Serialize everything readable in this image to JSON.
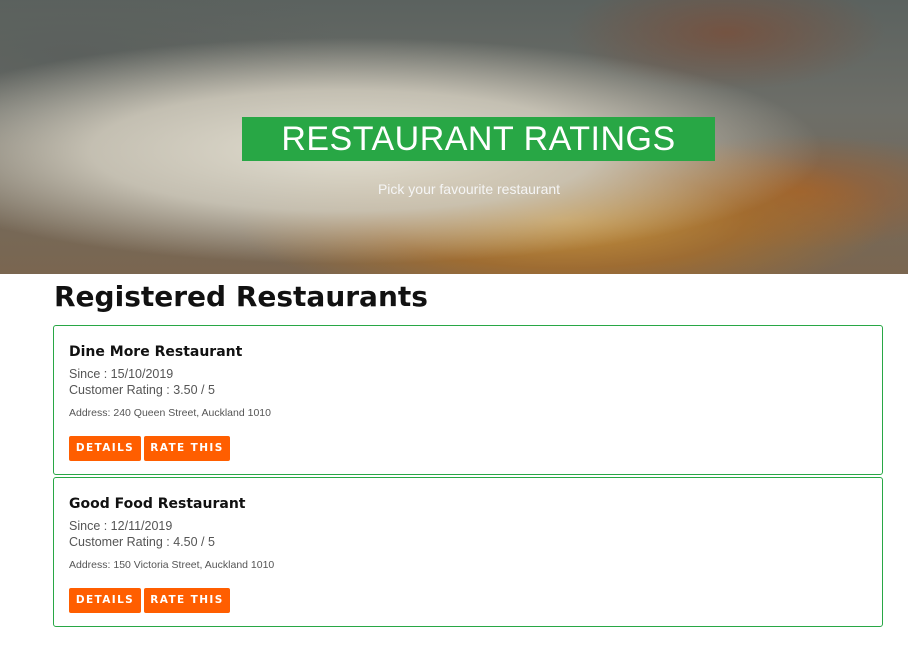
{
  "hero": {
    "title": "RESTAURANT RATINGS",
    "subtitle": "Pick your favourite restaurant",
    "title_bg_color": "#28a745"
  },
  "main": {
    "heading": "Registered Restaurants",
    "restaurants": [
      {
        "name": "Dine More Restaurant",
        "since": "Since : 15/10/2019",
        "rating": "Customer Rating : 3.50 / 5",
        "address": "Address: 240 Queen Street, Auckland 1010",
        "details_label": "DETAILS",
        "rate_label": "RATE THIS"
      },
      {
        "name": "Good Food Restaurant",
        "since": "Since : 12/11/2019",
        "rating": "Customer Rating : 4.50 / 5",
        "address": "Address: 150 Victoria Street, Auckland 1010",
        "details_label": "DETAILS",
        "rate_label": "RATE THIS"
      }
    ]
  },
  "colors": {
    "accent_green": "#28a745",
    "button_orange": "#ff5e00"
  }
}
